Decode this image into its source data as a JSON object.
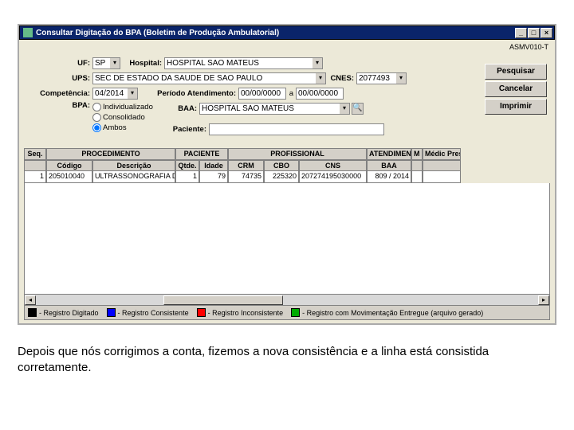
{
  "window": {
    "title": "Consultar Digitação do BPA (Boletim de Produção Ambulatorial)",
    "code": "ASMV010-T"
  },
  "form": {
    "uf_label": "UF:",
    "uf": "SP",
    "hospital_label": "Hospital:",
    "hospital": "HOSPITAL SAO MATEUS",
    "ups_label": "UPS:",
    "ups": "SEC DE ESTADO DA SAUDE DE SAO PAULO",
    "cnes_label": "CNES:",
    "cnes": "2077493",
    "competencia_label": "Competência:",
    "competencia": "04/2014",
    "periodo_label": "Período Atendimento:",
    "periodo_de": "00/00/0000",
    "periodo_a_label": "a",
    "periodo_a": "00/00/0000",
    "bpa_label": "BPA:",
    "bpa_options": {
      "ind": "Individualizado",
      "con": "Consolidado",
      "amb": "Ambos"
    },
    "baa_label": "BAA:",
    "baa": "HOSPITAL SAO MATEUS",
    "paciente_label": "Paciente:",
    "paciente": ""
  },
  "buttons": {
    "pesquisar": "Pesquisar",
    "cancelar": "Cancelar",
    "imprimir": "Imprimir"
  },
  "grid": {
    "group_headers": {
      "seq": "Seq.",
      "proc": "PROCEDIMENTO",
      "pac": "PACIENTE",
      "prof": "PROFISSIONAL",
      "atend": "ATENDIMENTO",
      "mp": "M P",
      "medic": "Médic Presta"
    },
    "headers": {
      "codigo": "Código",
      "descricao": "Descrição",
      "qtde": "Qtde.",
      "idade": "Idade",
      "crm": "CRM",
      "cbo": "CBO",
      "cns": "CNS",
      "baa": "BAA"
    },
    "row": {
      "seq": "1",
      "codigo": "205010040",
      "descricao": "ULTRASSONOGRAFIA DOPPL",
      "qtde": "1",
      "idade": "79",
      "crm": "74735",
      "cbo": "225320",
      "cns": "207274195030000",
      "baa": "809 / 2014",
      "mp": "",
      "medic": ""
    }
  },
  "legend": {
    "l1": "- Registro Digitado",
    "l2": "- Registro Consistente",
    "l3": "- Registro Inconsistente",
    "l4": "- Registro com Movimentação Entregue (arquivo gerado)"
  },
  "caption": "Depois que nós corrigimos a conta, fizemos a nova consistência e a linha está consistida corretamente."
}
